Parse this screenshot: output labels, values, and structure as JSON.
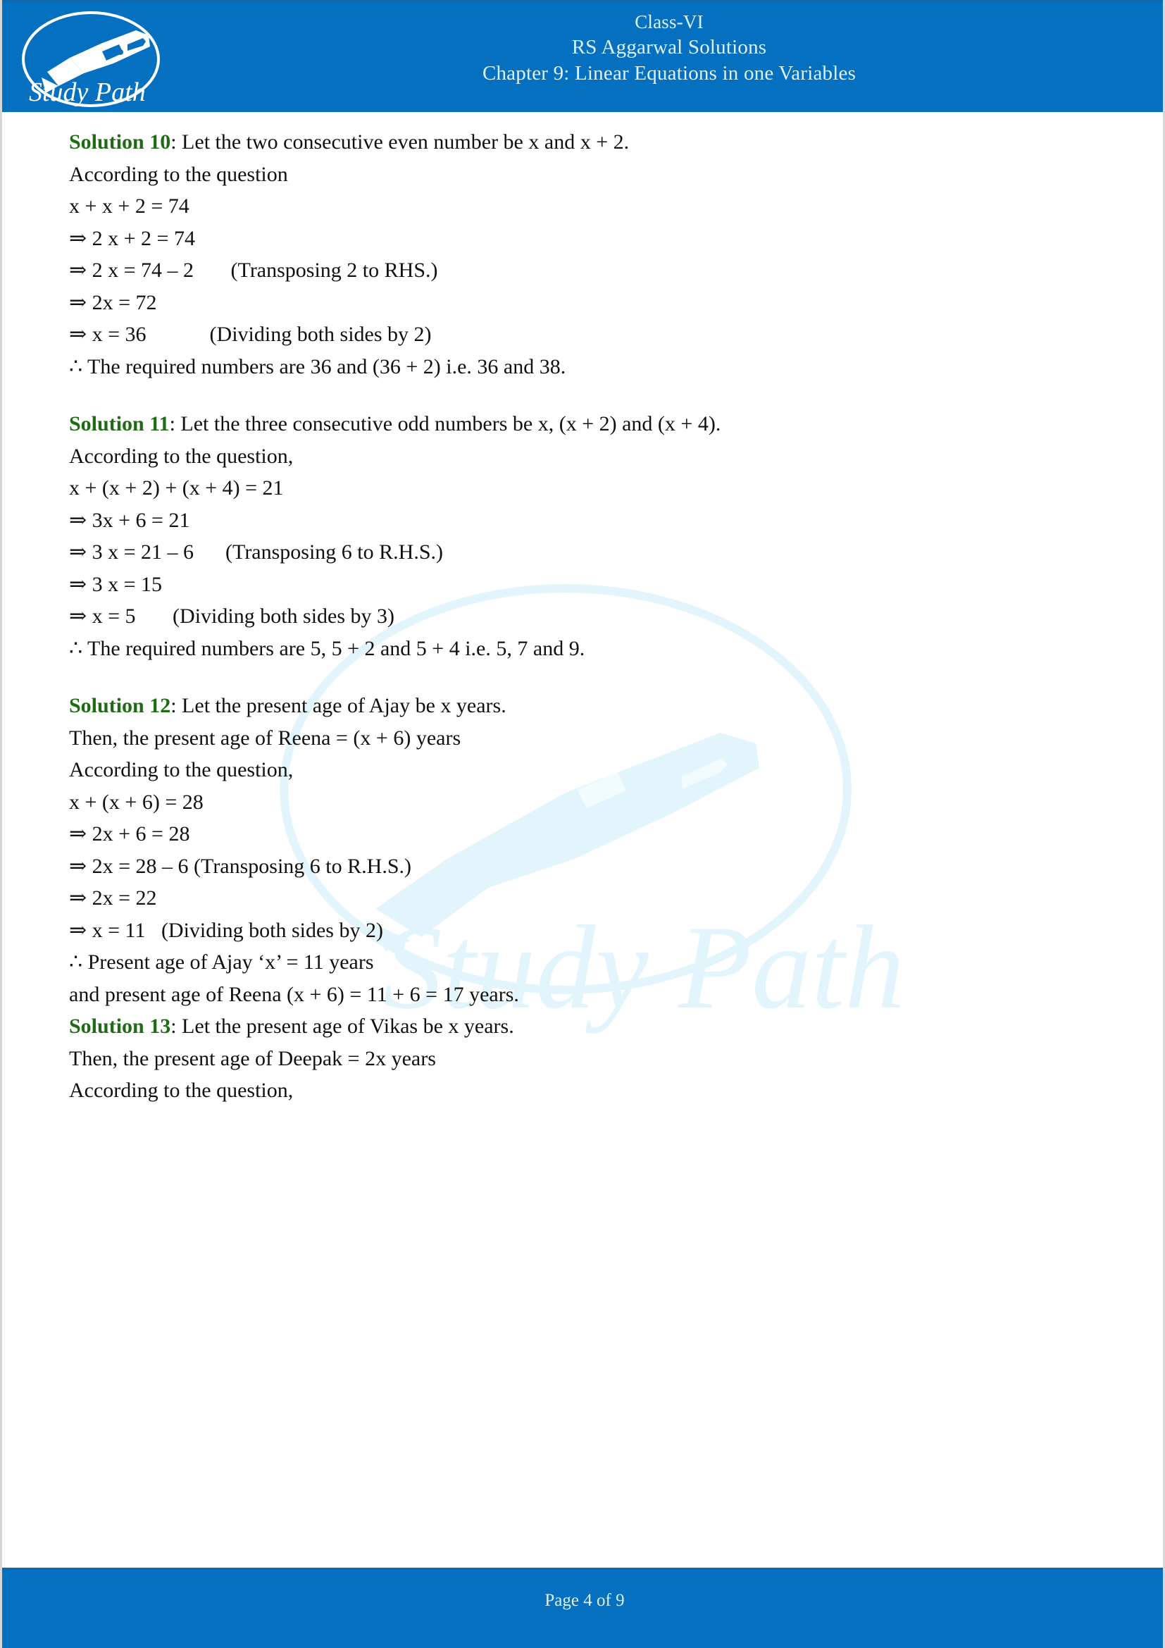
{
  "header": {
    "logo_name": "study-path-logo",
    "logo_text": "Study Path",
    "line1": "Class-VI",
    "line2": "RS Aggarwal Solutions",
    "line3": "Chapter 9: Linear Equations in one Variables",
    "bg_color": "#0670c0",
    "text_color": "#ddf1fb"
  },
  "watermark": {
    "text": "Study Path",
    "color": "#e4f6fd"
  },
  "colors": {
    "accent_blue": "#0670c0",
    "solution_green": "#1f6b15",
    "body_text": "#111111"
  },
  "solutions": [
    {
      "label": "Solution 10",
      "lines": [
        ": Let the two consecutive even number be x and x + 2.",
        "According to the question",
        "x + x + 2 = 74",
        "⇒ 2 x + 2 = 74",
        "⇒ 2 x = 74 – 2       (Transposing 2 to RHS.)",
        "⇒ 2x = 72",
        "⇒ x = 36            (Dividing both sides by 2)",
        "∴ The required numbers are 36 and (36 + 2) i.e. 36 and 38."
      ]
    },
    {
      "label": "Solution 11",
      "lines": [
        ": Let the three consecutive odd numbers be x, (x + 2) and (x + 4).",
        "According to the question,",
        "x + (x + 2) + (x + 4) = 21",
        "⇒ 3x + 6 = 21",
        "⇒ 3 x = 21 – 6      (Transposing 6 to R.H.S.)",
        "⇒ 3 x = 15",
        "⇒ x = 5       (Dividing both sides by 3)",
        "∴ The required numbers are 5, 5 + 2 and 5 + 4 i.e. 5, 7 and 9."
      ]
    },
    {
      "label": "Solution 12",
      "lines": [
        ": Let the present age of Ajay be x years.",
        "Then, the present age of Reena = (x + 6) years",
        "According to the question,",
        "x + (x + 6) = 28",
        "⇒ 2x + 6 = 28",
        "⇒ 2x = 28 – 6 (Transposing 6 to R.H.S.)",
        "⇒ 2x = 22",
        "⇒ x = 11   (Dividing both sides by 2)",
        "∴ Present age of Ajay ‘x’ = 11 years",
        "and present age of Reena (x + 6) = 11 + 6 = 17 years."
      ]
    },
    {
      "label": "Solution 13",
      "lines": [
        ": Let the present age of Vikas be x years.",
        "Then, the present age of Deepak = 2x years",
        "According to the question,"
      ]
    }
  ],
  "footer": {
    "page_text": "Page 4 of 9"
  }
}
